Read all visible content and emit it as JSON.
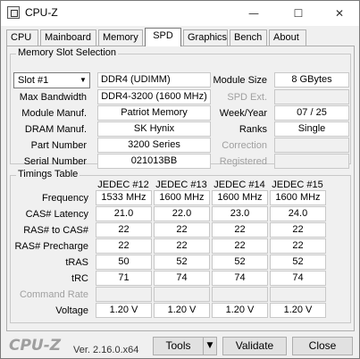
{
  "window": {
    "title": "CPU-Z",
    "minimize_glyph": "—",
    "maximize_glyph": "☐",
    "close_glyph": "✕"
  },
  "tabs": [
    {
      "label": "CPU",
      "active": false
    },
    {
      "label": "Mainboard",
      "active": false
    },
    {
      "label": "Memory",
      "active": false
    },
    {
      "label": "SPD",
      "active": true
    },
    {
      "label": "Graphics",
      "active": false
    },
    {
      "label": "Bench",
      "active": false
    },
    {
      "label": "About",
      "active": false
    }
  ],
  "memory_slot": {
    "group_title": "Memory Slot Selection",
    "slot_value": "Slot #1",
    "type_value": "DDR4 (UDIMM)",
    "labels": {
      "max_bandwidth": "Max Bandwidth",
      "module_manuf": "Module Manuf.",
      "dram_manuf": "DRAM Manuf.",
      "part_number": "Part Number",
      "serial_number": "Serial Number",
      "module_size": "Module Size",
      "spd_ext": "SPD Ext.",
      "week_year": "Week/Year",
      "ranks": "Ranks",
      "correction": "Correction",
      "registered": "Registered"
    },
    "values": {
      "max_bandwidth": "DDR4-3200 (1600 MHz)",
      "module_manuf": "Patriot Memory",
      "dram_manuf": "SK Hynix",
      "part_number": "3200 Series",
      "serial_number": "021013BB",
      "module_size": "8 GBytes",
      "spd_ext": "",
      "week_year": "07 / 25",
      "ranks": "Single",
      "correction": "",
      "registered": ""
    }
  },
  "timings": {
    "group_title": "Timings Table",
    "columns": [
      "JEDEC #12",
      "JEDEC #13",
      "JEDEC #14",
      "JEDEC #15"
    ],
    "rows": [
      {
        "label": "Frequency",
        "values": [
          "1533 MHz",
          "1600 MHz",
          "1600 MHz",
          "1600 MHz"
        ],
        "dim": false
      },
      {
        "label": "CAS# Latency",
        "values": [
          "21.0",
          "22.0",
          "23.0",
          "24.0"
        ],
        "dim": false
      },
      {
        "label": "RAS# to CAS#",
        "values": [
          "22",
          "22",
          "22",
          "22"
        ],
        "dim": false
      },
      {
        "label": "RAS# Precharge",
        "values": [
          "22",
          "22",
          "22",
          "22"
        ],
        "dim": false
      },
      {
        "label": "tRAS",
        "values": [
          "50",
          "52",
          "52",
          "52"
        ],
        "dim": false
      },
      {
        "label": "tRC",
        "values": [
          "71",
          "74",
          "74",
          "74"
        ],
        "dim": false
      },
      {
        "label": "Command Rate",
        "values": [
          "",
          "",
          "",
          ""
        ],
        "dim": true
      },
      {
        "label": "Voltage",
        "values": [
          "1.20 V",
          "1.20 V",
          "1.20 V",
          "1.20 V"
        ],
        "dim": false
      }
    ]
  },
  "footer": {
    "logo": "CPU-Z",
    "version": "Ver. 2.16.0.x64",
    "tools_label": "Tools",
    "validate_label": "Validate",
    "close_label": "Close"
  }
}
